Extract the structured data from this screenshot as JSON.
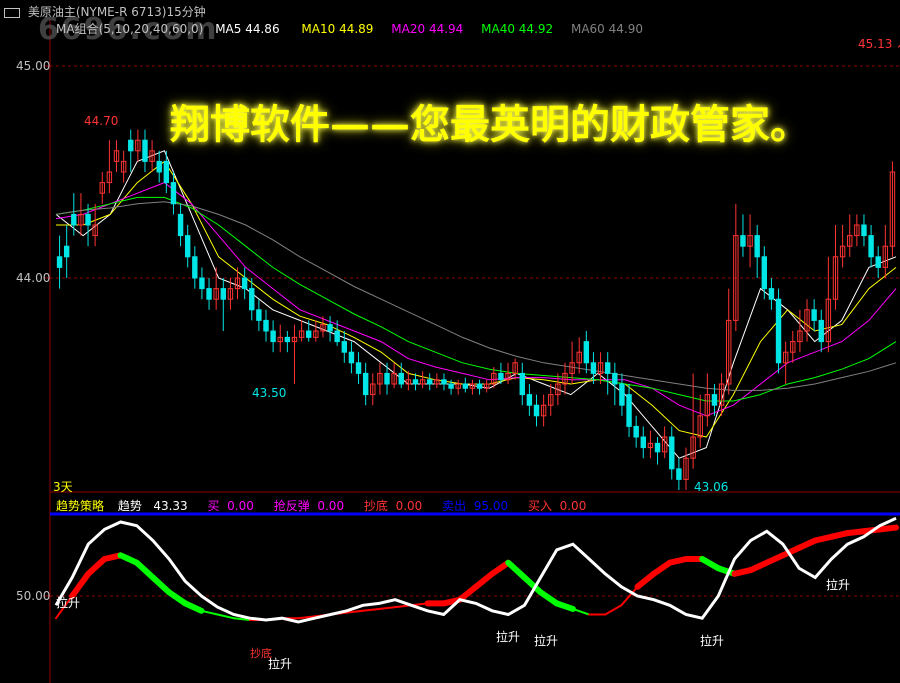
{
  "window": {
    "title": "美原油主(NYME-R 6713)15分钟",
    "watermark": "6696.com"
  },
  "colors": {
    "bg": "#000000",
    "grid": "#8b0000",
    "up": "#ff3333",
    "down": "#00e5e5",
    "ma5": "#ffffff",
    "ma10": "#ffff00",
    "ma20": "#ff00ff",
    "ma40": "#00ff00",
    "ma60": "#808080",
    "banner": "#ffff00",
    "panel_divider": "#0000ff"
  },
  "ma_header": {
    "group_label": "MA组合(5,10,20,40,60,0)",
    "items": [
      {
        "label": "MA5",
        "value": "44.86",
        "color": "#ffffff"
      },
      {
        "label": "MA10",
        "value": "44.89",
        "color": "#ffff00"
      },
      {
        "label": "MA20",
        "value": "44.94",
        "color": "#ff00ff"
      },
      {
        "label": "MA40",
        "value": "44.92",
        "color": "#00ff00"
      },
      {
        "label": "MA60",
        "value": "44.90",
        "color": "#808080"
      }
    ]
  },
  "price_axis": {
    "high_label": "45.00",
    "low_label": "44.00",
    "current_price": "45.13"
  },
  "annotations": {
    "peak": "44.70",
    "low1": "43.50",
    "low2": "43.06",
    "period": "3天"
  },
  "banner": "翔博软件——您最英明的财政管家。",
  "indicator_header": {
    "name": "趋势策略",
    "items": [
      {
        "label": "趋势",
        "value": "43.33",
        "label_color": "#ffffff",
        "value_color": "#ffffff"
      },
      {
        "label": "买",
        "value": "0.00",
        "label_color": "#ff00ff",
        "value_color": "#ff00ff"
      },
      {
        "label": "抢反弹",
        "value": "0.00",
        "label_color": "#ff00ff",
        "value_color": "#ff00ff"
      },
      {
        "label": "抄底",
        "value": "0.00",
        "label_color": "#ff3333",
        "value_color": "#ff3333"
      },
      {
        "label": "卖出",
        "value": "95.00",
        "label_color": "#0000ff",
        "value_color": "#0000ff"
      },
      {
        "label": "买入",
        "value": "0.00",
        "label_color": "#ff3333",
        "value_color": "#ff3333"
      }
    ]
  },
  "indicator_axis": {
    "mid_label": "50.00"
  },
  "signals": {
    "rise": "拉升",
    "bottom": "抄底"
  },
  "chart_data": {
    "type": "candlestick",
    "price_range": [
      43.0,
      45.13
    ],
    "candles": [
      [
        44.1,
        44.05,
        44.2,
        43.95
      ],
      [
        44.15,
        44.1,
        44.25,
        44.0
      ],
      [
        44.3,
        44.25,
        44.4,
        44.2
      ],
      [
        44.25,
        44.3,
        44.4,
        44.2
      ],
      [
        44.3,
        44.25,
        44.35,
        44.15
      ],
      [
        44.2,
        44.25,
        44.35,
        44.15
      ],
      [
        44.4,
        44.45,
        44.5,
        44.35
      ],
      [
        44.45,
        44.5,
        44.65,
        44.4
      ],
      [
        44.55,
        44.6,
        44.65,
        44.5
      ],
      [
        44.5,
        44.55,
        44.6,
        44.45
      ],
      [
        44.65,
        44.6,
        44.7,
        44.5
      ],
      [
        44.6,
        44.65,
        44.7,
        44.55
      ],
      [
        44.65,
        44.55,
        44.7,
        44.5
      ],
      [
        44.55,
        44.6,
        44.65,
        44.5
      ],
      [
        44.55,
        44.5,
        44.6,
        44.45
      ],
      [
        44.55,
        44.45,
        44.6,
        44.4
      ],
      [
        44.45,
        44.35,
        44.5,
        44.3
      ],
      [
        44.3,
        44.2,
        44.35,
        44.15
      ],
      [
        44.2,
        44.1,
        44.25,
        44.05
      ],
      [
        44.1,
        44.0,
        44.15,
        43.95
      ],
      [
        44.0,
        43.95,
        44.05,
        43.9
      ],
      [
        43.95,
        43.9,
        44.0,
        43.85
      ],
      [
        43.9,
        43.95,
        44.05,
        43.85
      ],
      [
        43.95,
        43.9,
        44.0,
        43.75
      ],
      [
        43.9,
        43.95,
        44.0,
        43.85
      ],
      [
        43.95,
        44.0,
        44.05,
        43.9
      ],
      [
        44.0,
        43.95,
        44.05,
        43.9
      ],
      [
        43.95,
        43.85,
        44.0,
        43.8
      ],
      [
        43.85,
        43.8,
        43.9,
        43.75
      ],
      [
        43.8,
        43.75,
        43.85,
        43.7
      ],
      [
        43.75,
        43.7,
        43.8,
        43.65
      ],
      [
        43.7,
        43.72,
        43.78,
        43.65
      ],
      [
        43.72,
        43.7,
        43.75,
        43.65
      ],
      [
        43.7,
        43.72,
        43.78,
        43.5
      ],
      [
        43.72,
        43.75,
        43.8,
        43.7
      ],
      [
        43.75,
        43.72,
        43.8,
        43.7
      ],
      [
        43.72,
        43.75,
        43.8,
        43.7
      ],
      [
        43.75,
        43.78,
        43.82,
        43.72
      ],
      [
        43.78,
        43.75,
        43.82,
        43.7
      ],
      [
        43.75,
        43.7,
        43.8,
        43.68
      ],
      [
        43.7,
        43.65,
        43.75,
        43.6
      ],
      [
        43.65,
        43.6,
        43.7,
        43.55
      ],
      [
        43.6,
        43.55,
        43.65,
        43.5
      ],
      [
        43.55,
        43.45,
        43.6,
        43.4
      ],
      [
        43.45,
        43.5,
        43.55,
        43.4
      ],
      [
        43.5,
        43.55,
        43.6,
        43.45
      ],
      [
        43.55,
        43.5,
        43.6,
        43.45
      ],
      [
        43.5,
        43.55,
        43.6,
        43.48
      ],
      [
        43.55,
        43.5,
        43.6,
        43.48
      ],
      [
        43.5,
        43.52,
        43.56,
        43.47
      ],
      [
        43.52,
        43.5,
        43.55,
        43.47
      ],
      [
        43.5,
        43.52,
        43.56,
        43.48
      ],
      [
        43.52,
        43.5,
        43.55,
        43.47
      ],
      [
        43.5,
        43.52,
        43.55,
        43.48
      ],
      [
        43.52,
        43.5,
        43.55,
        43.47
      ],
      [
        43.5,
        43.48,
        43.52,
        43.45
      ],
      [
        43.48,
        43.5,
        43.52,
        43.45
      ],
      [
        43.5,
        43.48,
        43.53,
        43.46
      ],
      [
        43.48,
        43.5,
        43.52,
        43.45
      ],
      [
        43.5,
        43.48,
        43.52,
        43.45
      ],
      [
        43.48,
        43.5,
        43.52,
        43.46
      ],
      [
        43.5,
        43.55,
        43.58,
        43.48
      ],
      [
        43.55,
        43.52,
        43.6,
        43.5
      ],
      [
        43.52,
        43.55,
        43.6,
        43.5
      ],
      [
        43.55,
        43.6,
        43.62,
        43.52
      ],
      [
        43.55,
        43.45,
        43.6,
        43.4
      ],
      [
        43.45,
        43.4,
        43.5,
        43.35
      ],
      [
        43.4,
        43.35,
        43.45,
        43.3
      ],
      [
        43.35,
        43.4,
        43.45,
        43.3
      ],
      [
        43.4,
        43.45,
        43.5,
        43.35
      ],
      [
        43.45,
        43.5,
        43.55,
        43.4
      ],
      [
        43.5,
        43.55,
        43.6,
        43.45
      ],
      [
        43.55,
        43.6,
        43.7,
        43.5
      ],
      [
        43.6,
        43.65,
        43.72,
        43.55
      ],
      [
        43.7,
        43.6,
        43.75,
        43.55
      ],
      [
        43.6,
        43.55,
        43.65,
        43.5
      ],
      [
        43.55,
        43.6,
        43.65,
        43.5
      ],
      [
        43.6,
        43.55,
        43.65,
        43.45
      ],
      [
        43.55,
        43.5,
        43.6,
        43.4
      ],
      [
        43.5,
        43.4,
        43.55,
        43.35
      ],
      [
        43.45,
        43.3,
        43.5,
        43.25
      ],
      [
        43.3,
        43.25,
        43.35,
        43.2
      ],
      [
        43.25,
        43.2,
        43.3,
        43.15
      ],
      [
        43.2,
        43.22,
        43.28,
        43.15
      ],
      [
        43.22,
        43.18,
        43.25,
        43.12
      ],
      [
        43.18,
        43.25,
        43.3,
        43.15
      ],
      [
        43.25,
        43.1,
        43.3,
        43.05
      ],
      [
        43.1,
        43.05,
        43.15,
        43.0
      ],
      [
        43.05,
        43.15,
        43.2,
        43.0
      ],
      [
        43.15,
        43.25,
        43.55,
        43.1
      ],
      [
        43.25,
        43.35,
        43.45,
        43.2
      ],
      [
        43.35,
        43.45,
        43.55,
        43.3
      ],
      [
        43.45,
        43.4,
        43.5,
        43.35
      ],
      [
        43.4,
        43.5,
        43.55,
        43.35
      ],
      [
        43.5,
        43.8,
        43.95,
        43.45
      ],
      [
        43.8,
        44.2,
        44.35,
        43.75
      ],
      [
        44.2,
        44.15,
        44.3,
        44.1
      ],
      [
        44.15,
        44.2,
        44.3,
        44.05
      ],
      [
        44.2,
        44.1,
        44.25,
        44.0
      ],
      [
        44.1,
        43.95,
        44.15,
        43.9
      ],
      [
        43.95,
        43.9,
        44.0,
        43.85
      ],
      [
        43.9,
        43.6,
        43.95,
        43.55
      ],
      [
        43.6,
        43.65,
        43.7,
        43.5
      ],
      [
        43.65,
        43.7,
        43.75,
        43.6
      ],
      [
        43.7,
        43.75,
        43.85,
        43.65
      ],
      [
        43.75,
        43.85,
        43.9,
        43.7
      ],
      [
        43.85,
        43.8,
        43.9,
        43.75
      ],
      [
        43.8,
        43.7,
        43.85,
        43.65
      ],
      [
        43.7,
        43.9,
        44.1,
        43.65
      ],
      [
        43.9,
        44.1,
        44.25,
        43.85
      ],
      [
        44.1,
        44.15,
        44.25,
        44.05
      ],
      [
        44.15,
        44.2,
        44.3,
        44.1
      ],
      [
        44.2,
        44.25,
        44.3,
        44.15
      ],
      [
        44.25,
        44.2,
        44.3,
        44.15
      ],
      [
        44.2,
        44.1,
        44.25,
        44.05
      ],
      [
        44.1,
        44.05,
        44.15,
        44.0
      ],
      [
        44.05,
        44.15,
        44.25,
        44.0
      ],
      [
        44.15,
        44.5,
        44.55,
        44.1
      ]
    ],
    "moving_averages": {
      "MA5": {
        "color": "#ffffff",
        "values": [
          44.3,
          44.2,
          44.3,
          44.55,
          44.6,
          44.3,
          44.0,
          43.95,
          43.85,
          43.8,
          43.75,
          43.7,
          43.6,
          43.5,
          43.5,
          43.5,
          43.48,
          43.55,
          43.5,
          43.45,
          43.55,
          43.45,
          43.3,
          43.15,
          43.2,
          43.6,
          43.95,
          43.85,
          43.7,
          43.8,
          44.05,
          44.1
        ]
      },
      "MA10": {
        "color": "#ffff00",
        "values": [
          44.25,
          44.25,
          44.3,
          44.45,
          44.55,
          44.35,
          44.1,
          44.0,
          43.9,
          43.82,
          43.78,
          43.72,
          43.65,
          43.55,
          43.52,
          43.5,
          43.5,
          43.53,
          43.52,
          43.5,
          43.52,
          43.5,
          43.4,
          43.28,
          43.25,
          43.45,
          43.7,
          43.85,
          43.75,
          43.78,
          43.95,
          44.05
        ]
      },
      "MA20": {
        "color": "#ff00ff",
        "values": [
          44.28,
          44.3,
          44.35,
          44.4,
          44.45,
          44.35,
          44.2,
          44.05,
          43.95,
          43.85,
          43.8,
          43.75,
          43.7,
          43.62,
          43.58,
          43.55,
          43.52,
          43.53,
          43.53,
          43.52,
          43.52,
          43.52,
          43.48,
          43.4,
          43.35,
          43.4,
          43.5,
          43.6,
          43.65,
          43.7,
          43.8,
          43.95
        ]
      },
      "MA40": {
        "color": "#00ff00",
        "values": [
          44.3,
          44.32,
          44.35,
          44.38,
          44.38,
          44.33,
          44.25,
          44.15,
          44.05,
          43.97,
          43.9,
          43.83,
          43.77,
          43.7,
          43.65,
          43.6,
          43.57,
          43.55,
          43.54,
          43.53,
          43.52,
          43.5,
          43.48,
          43.45,
          43.42,
          43.42,
          43.45,
          43.5,
          43.53,
          43.57,
          43.62,
          43.7
        ]
      },
      "MA60": {
        "color": "#808080",
        "values": [
          44.3,
          44.32,
          44.33,
          44.35,
          44.36,
          44.34,
          44.3,
          44.25,
          44.18,
          44.1,
          44.03,
          43.96,
          43.9,
          43.84,
          43.78,
          43.72,
          43.67,
          43.63,
          43.6,
          43.58,
          43.56,
          43.54,
          43.52,
          43.5,
          43.48,
          43.47,
          43.47,
          43.48,
          43.5,
          43.53,
          43.56,
          43.6
        ]
      }
    },
    "trend_line": {
      "name": "趋势",
      "values": [
        45,
        60,
        78,
        86,
        90,
        88,
        80,
        70,
        58,
        50,
        44,
        40,
        38,
        37,
        38,
        36,
        38,
        40,
        42,
        45,
        46,
        48,
        45,
        42,
        40,
        48,
        46,
        42,
        40,
        45,
        60,
        75,
        78,
        70,
        62,
        55,
        50,
        48,
        45,
        40,
        38,
        50,
        70,
        80,
        85,
        78,
        65,
        60,
        70,
        78,
        82,
        88,
        92
      ]
    },
    "signal_ribbon": {
      "values": [
        38,
        50,
        62,
        70,
        72,
        68,
        60,
        52,
        46,
        42,
        40,
        38,
        37,
        37,
        38,
        38,
        39,
        40,
        41,
        42,
        43,
        44,
        45,
        46,
        46,
        48,
        55,
        62,
        68,
        60,
        52,
        46,
        43,
        40,
        40,
        45,
        55,
        62,
        68,
        70,
        70,
        65,
        62,
        64,
        68,
        72,
        76,
        80,
        82,
        84,
        85,
        86,
        87
      ]
    }
  }
}
